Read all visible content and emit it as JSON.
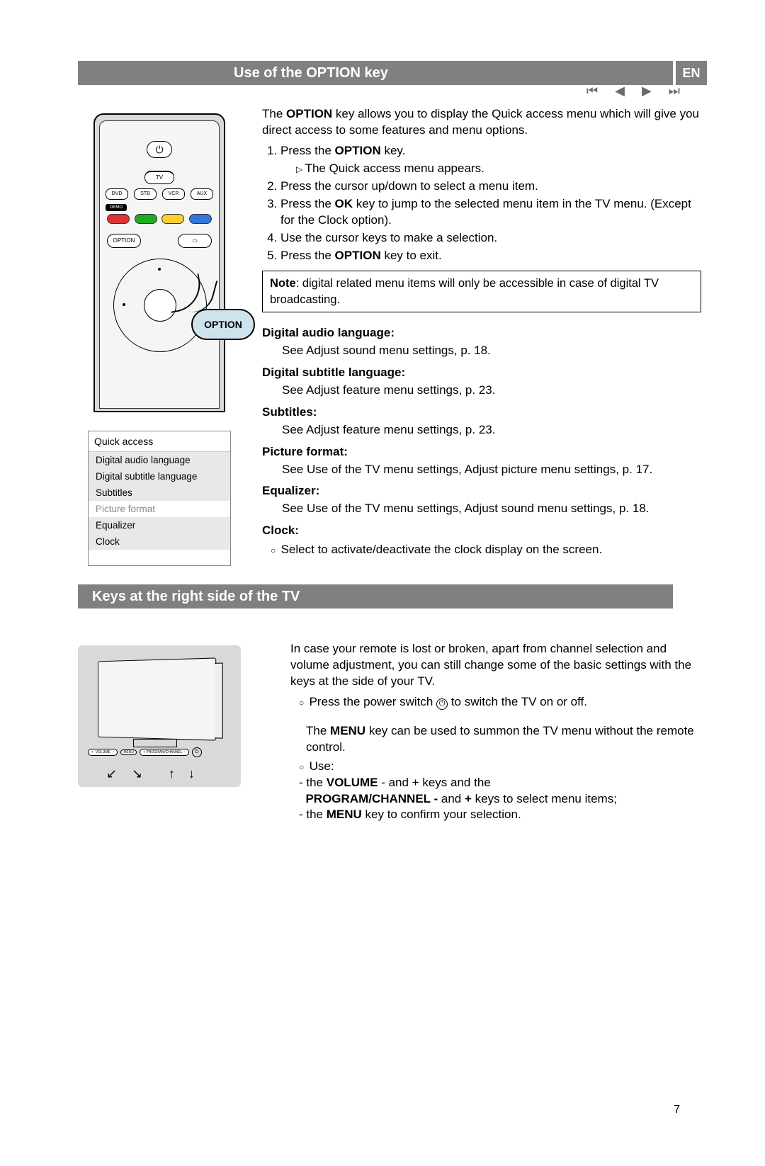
{
  "nav": {
    "first": "⏮",
    "prev": "◀",
    "next": "▶",
    "last": "⏭"
  },
  "lang_badge": "EN",
  "page_number": "7",
  "section1": {
    "title": "Use of the OPTION key",
    "intro": "The OPTION key allows you to display the Quick access menu which will give you direct access to some features and menu options.",
    "intro_bold": "OPTION",
    "steps": {
      "s1a": "Press the ",
      "s1b": "OPTION",
      "s1c": " key.",
      "s1_sub": "The Quick access menu appears.",
      "s2": "Press the cursor up/down to select a menu item.",
      "s3a": "Press the ",
      "s3b": "OK",
      "s3c": " key to jump to the selected menu item in the TV menu. (Except for the Clock option).",
      "s4": "Use the cursor keys to make a selection.",
      "s5a": "Press the ",
      "s5b": "OPTION",
      "s5c": " key to exit."
    },
    "note": {
      "bold": "Note",
      "text": ": digital related menu items will only be accessible in case of digital TV broadcasting."
    },
    "defs": {
      "d1t": "Digital audio language:",
      "d1b": "See Adjust sound menu settings, p. 18.",
      "d2t": "Digital subtitle language:",
      "d2b": "See Adjust feature menu settings, p. 23.",
      "d3t": "Subtitles:",
      "d3b": "See Adjust feature menu settings, p. 23.",
      "d4t": "Picture format:",
      "d4b": "See Use of the TV menu settings, Adjust picture menu settings, p. 17.",
      "d5t": "Equalizer:",
      "d5b": "See Use of the TV menu settings, Adjust sound menu settings, p. 18.",
      "d6t": "Clock:",
      "d6b": "Select to activate/deactivate the clock display on the screen."
    }
  },
  "remote": {
    "power": "⏻",
    "tv": "TV",
    "src": [
      "DVD",
      "STB",
      "VCR",
      "AUX"
    ],
    "demo": "DEMO",
    "option": "OPTION",
    "guide": "▭",
    "callout": "OPTION"
  },
  "quick_menu": {
    "title": "Quick access",
    "items": [
      "Digital audio language",
      "Digital subtitle language",
      "Subtitles",
      "Picture format",
      "Equalizer",
      "Clock"
    ],
    "selected_index": 3
  },
  "section2": {
    "title": "Keys at the right side of the TV",
    "p1": "In case your remote is lost or broken, apart from channel selection and volume adjustment, you can still change some of the basic settings with the keys at the side of your TV.",
    "p2a": "Press the power switch ",
    "p2b": " to switch the TV on or off.",
    "p3a": "The ",
    "p3b": "MENU",
    "p3c": " key can be used to summon the TV menu without the remote control.",
    "use_label": "Use:",
    "use_l1a": "- the ",
    "use_l1b": "VOLUME",
    "use_l1c": " - and + keys and the",
    "use_l2a": "PROGRAM/CHANNEL -",
    "use_l2b": " and ",
    "use_l2c": "+",
    "use_l2d": "  keys to select menu items;",
    "use_l3a": "- the ",
    "use_l3b": "MENU",
    "use_l3c": " key to confirm your selection."
  },
  "tv_buttons": {
    "vol": "VOLUME",
    "menu": "MENU",
    "prog": "PROGRAM/CHANNEL",
    "plus": "+",
    "minus": "–"
  }
}
